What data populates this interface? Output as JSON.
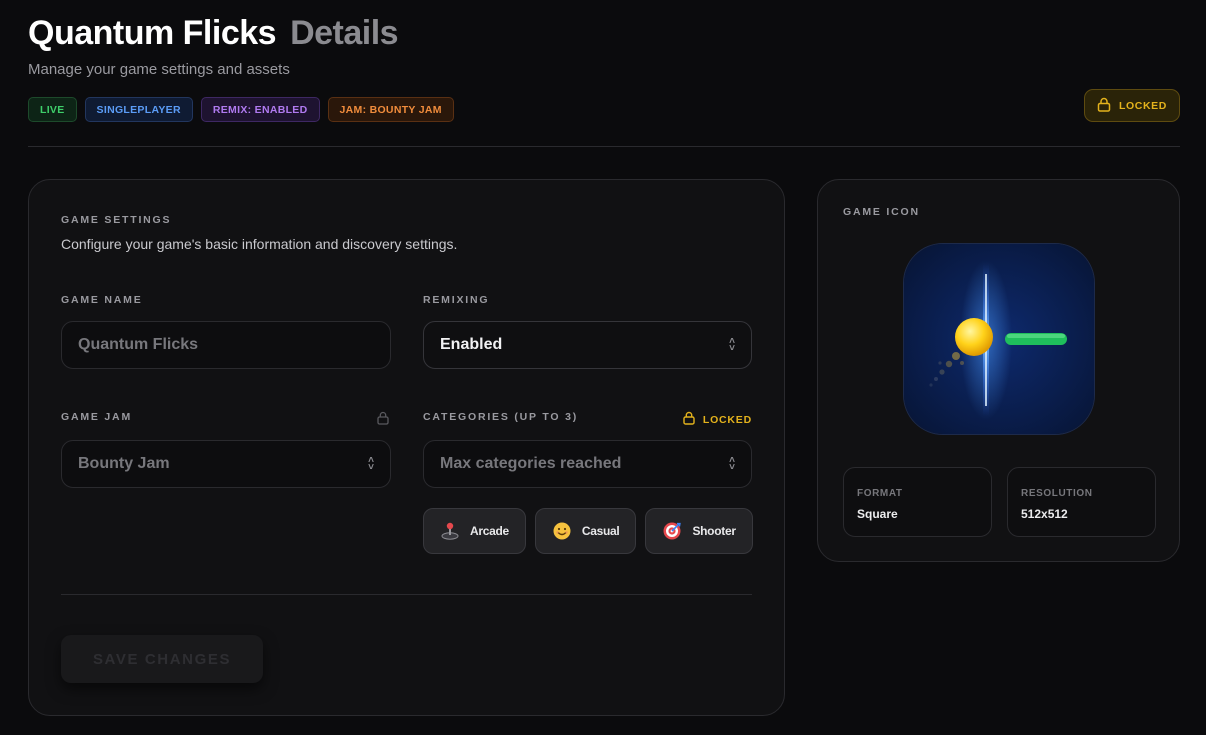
{
  "header": {
    "title": "Quantum Flicks",
    "title_suffix": "Details",
    "subtitle": "Manage your game settings and assets",
    "tags": [
      "LIVE",
      "SINGLEPLAYER",
      "REMIX: ENABLED",
      "JAM: BOUNTY JAM"
    ],
    "lock_status": "LOCKED"
  },
  "settings": {
    "section_title": "GAME SETTINGS",
    "description": "Configure your game's basic information and discovery settings.",
    "game_name": {
      "label": "GAME NAME",
      "value": "Quantum Flicks"
    },
    "remixing": {
      "label": "REMIXING",
      "value": "Enabled"
    },
    "game_jam": {
      "label": "GAME JAM",
      "value": "Bounty Jam"
    },
    "categories": {
      "label": "CATEGORIES (UP TO 3)",
      "locked_label": "LOCKED",
      "value": "Max categories reached",
      "chips": [
        {
          "label": "Arcade",
          "icon": "joystick-icon"
        },
        {
          "label": "Casual",
          "icon": "smiley-icon"
        },
        {
          "label": "Shooter",
          "icon": "target-icon"
        }
      ]
    },
    "save_label": "SAVE CHANGES"
  },
  "game_icon": {
    "section_title": "GAME ICON",
    "format_label": "FORMAT",
    "format_value": "Square",
    "resolution_label": "RESOLUTION",
    "resolution_value": "512x512"
  },
  "colors": {
    "background": "#0b0b0d",
    "card": "#111113",
    "accent_locked": "#e3b21c",
    "tag_live": "#3ecf6a",
    "tag_singleplayer": "#5b9cf6",
    "tag_remix": "#b07af0",
    "tag_jam": "#f08c3c"
  }
}
